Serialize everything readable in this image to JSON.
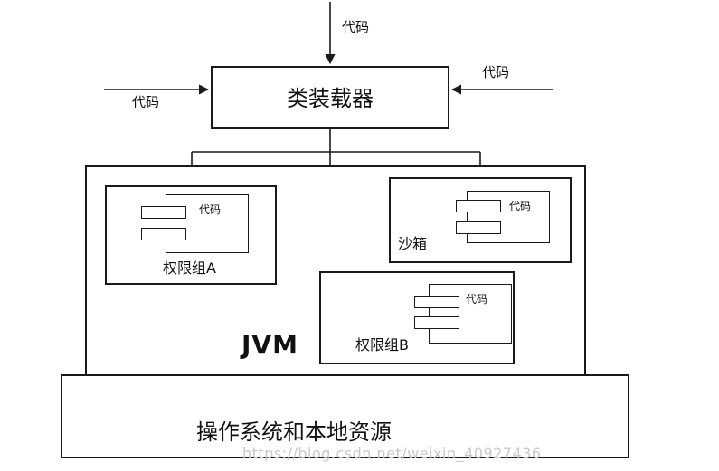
{
  "top_input_label": "代码",
  "left_input_label": "代码",
  "right_input_label": "代码",
  "classloader_label": "类装载器",
  "jvm_label": "JVM",
  "sandbox": {
    "code_label": "代码",
    "title": "沙箱"
  },
  "group_a": {
    "code_label": "代码",
    "title": "权限组A"
  },
  "group_b": {
    "code_label": "代码",
    "title": "权限组B"
  },
  "os_label": "操作系统和本地资源",
  "watermark": "https://blog.csdn.net/weixin_40927436"
}
